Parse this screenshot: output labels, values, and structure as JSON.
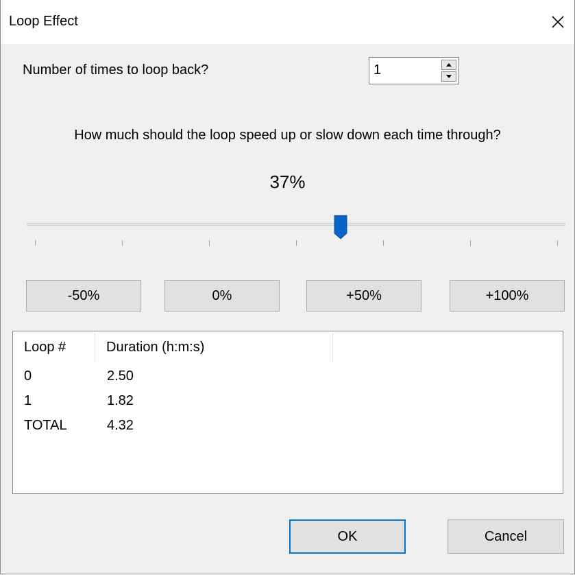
{
  "window": {
    "title": "Loop Effect"
  },
  "loop": {
    "label": "Number of times to loop back?",
    "value": "1"
  },
  "speed": {
    "question": "How much should the loop speed up or slow down each time through?",
    "percent_label": "37%",
    "slider_fraction": 0.583,
    "tick_count": 7
  },
  "presets": [
    "-50%",
    "0%",
    "+50%",
    "+100%"
  ],
  "table": {
    "columns": [
      "Loop #",
      "Duration (h:m:s)"
    ],
    "rows": [
      [
        "0",
        "2.50"
      ],
      [
        "1",
        "1.82"
      ],
      [
        "TOTAL",
        "4.32"
      ]
    ]
  },
  "buttons": {
    "ok": "OK",
    "cancel": "Cancel"
  },
  "colors": {
    "accent": "#0078d7",
    "thumb": "#0a64c8"
  }
}
